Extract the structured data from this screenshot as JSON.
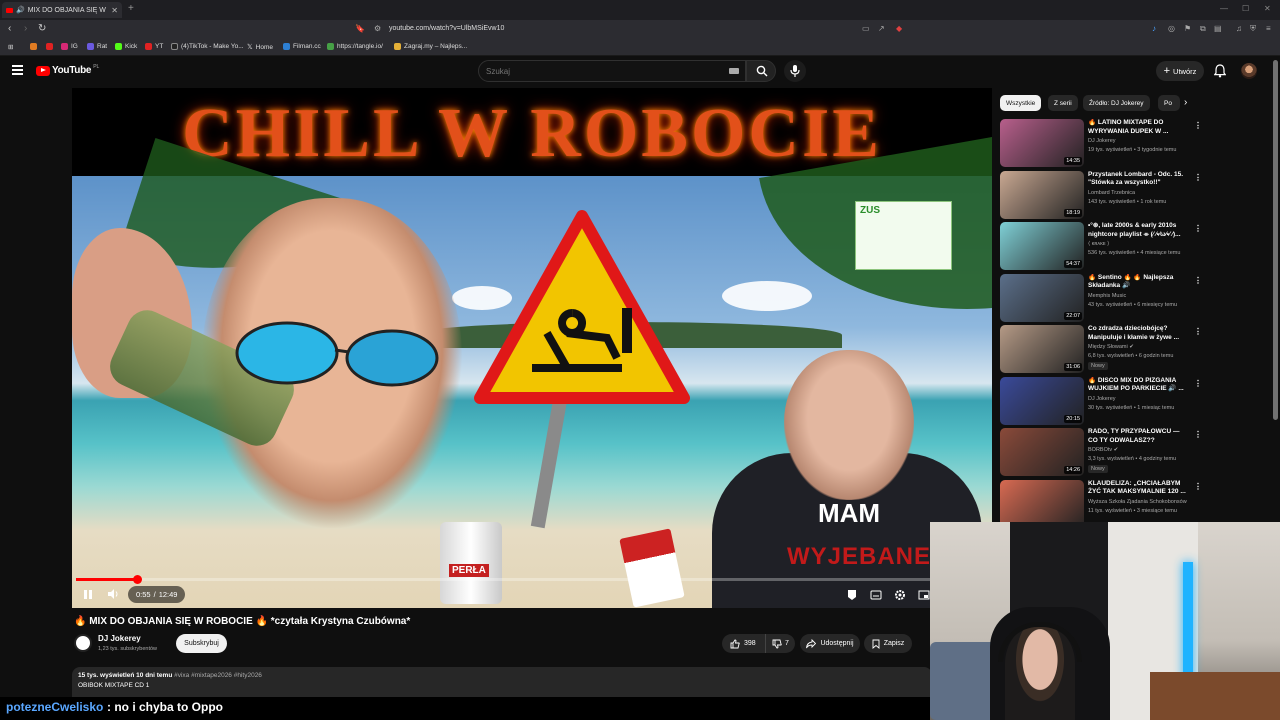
{
  "browser": {
    "tab_title": "MIX DO OBJANIA SIĘ W",
    "url": "youtube.com/watch?v=UlbMSiEvw10",
    "bookmarks": [
      "IG",
      "Rat",
      "Kick",
      "YT",
      "(4)TikTok - Make Yo...",
      "Home",
      "Filman.cc",
      "https://tangle.io/",
      "Zagraj.my – Najleps..."
    ]
  },
  "header": {
    "logo": "YouTube",
    "country": "PL",
    "search_placeholder": "Szukaj",
    "create_label": "Utwórz"
  },
  "player": {
    "banner_text": "CHILL W ROBOCIE",
    "time_current": "0:55",
    "time_total": "12:49",
    "progress": 0.0715,
    "shirt_line1": "MAM",
    "shirt_line2": "WYJEBANE",
    "can_label": "PERŁA",
    "sign_logo": "ZUS"
  },
  "video": {
    "title": "🔥 MIX DO OBJANIA SIĘ W ROBOCIE 🔥 *czytała Krystyna Czubówna*",
    "channel": "DJ Jokerey",
    "subscribers": "1,23 tys. subskrybentów",
    "subscribe_label": "Subskrybuj",
    "likes": "398",
    "dislikes": "7",
    "share_label": "Udostępnij",
    "save_label": "Zapisz",
    "views_date": "15 tys. wyświetleń  10 dni temu",
    "tags": "#vixa #mixtape2026 #hity2026",
    "desc_line": "OBIBOK MIXTAPE CD 1"
  },
  "chat": {
    "user": "potezneCwelisko",
    "message": ": no i chyba to Oppo"
  },
  "sidebar": {
    "chips": [
      "Wszystkie",
      "Z serii",
      "Źródło: DJ Jokerey",
      "Po"
    ],
    "recommendations": [
      {
        "title": "🔥 LATINO MIXTAPE DO WYRYWANIA DUPEK W ...",
        "channel": "DJ Jokerey",
        "meta": "19 tys. wyświetleń • 3 tygodnie temu",
        "duration": "14:35",
        "badge": "",
        "color": "#b85f8c"
      },
      {
        "title": "Przystanek Lombard - Odc. 15. \"Stówka za wszystko!!\"",
        "channel": "Lombard Trzebnica",
        "meta": "143 tys. wyświetleń • 1 rok temu",
        "duration": "18:19",
        "badge": "",
        "color": "#c9a892"
      },
      {
        "title": "•°⊛, late 2000s & early 2010s nightcore playlist ⌯ (⁄ ⁄•⁄ω⁄•⁄ ⁄)...",
        "channel": "⟨ ᴋʀᴀᴋᴇ ⟩",
        "meta": "536 tys. wyświetleń • 4 miesiące temu",
        "duration": "54:37",
        "badge": "",
        "color": "#7fd0d6"
      },
      {
        "title": "🔥 Sentino 🔥 🔥 Najlepsza Składanka 🔊",
        "channel": "Memphis Music",
        "meta": "43 tys. wyświetleń • 6 miesięcy temu",
        "duration": "22:07",
        "badge": "",
        "color": "#5b6f8a"
      },
      {
        "title": "Co zdradza dzieciobójcę? Manipuluje i kłamie w żywe ...",
        "channel": "Między Słowami ✔",
        "meta": "6,8 tys. wyświetleń • 6 godzin temu",
        "duration": "31:06",
        "badge": "Nowy",
        "color": "#b59a86"
      },
      {
        "title": "🔥 DISCO MIX DO PIZGANIA WUJKIEM PO PARKIECIE 🔊 ...",
        "channel": "DJ Jokerey",
        "meta": "30 tys. wyświetleń • 1 miesiąc temu",
        "duration": "20:15",
        "badge": "",
        "color": "#3a4a9a"
      },
      {
        "title": "RADO, TY PRZYPAŁOWCU — CO TY ODWALASZ??",
        "channel": "BORBOtv ✔",
        "meta": "3,3 tys. wyświetleń • 4 godziny temu",
        "duration": "14:26",
        "badge": "Nowy",
        "color": "#8a4a3a"
      },
      {
        "title": "KLAUDELIZA: „CHCIAŁABYM ŻYĆ TAK MAKSYMALNIE 120 ...",
        "channel": "Wyższa Szkoła Zjadania Schokobonsów",
        "meta": "11 tys. wyświetleń • 3 miesiące temu",
        "duration": "",
        "badge": "",
        "color": "#d86a52"
      }
    ]
  }
}
